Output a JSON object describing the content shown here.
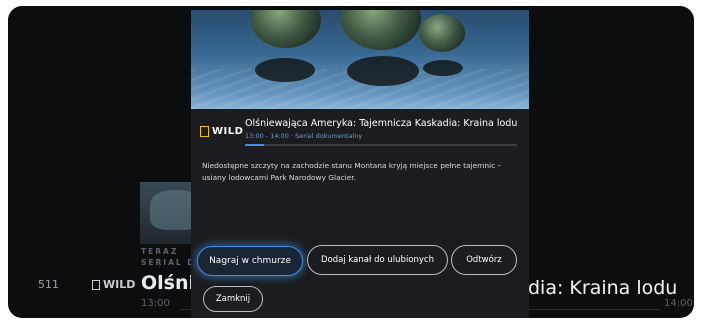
{
  "background_guide": {
    "channel_number": "511",
    "channel_logo": "WILD",
    "now_label": "TERAZ",
    "category_label": "SERIAL D",
    "title_left": "Olśnie",
    "title_right": "dia: Kraina lodu",
    "time_start": "13:00",
    "time_end": "14:00"
  },
  "modal": {
    "channel_logo": "WILD",
    "program_title": "Olśniewająca Ameryka: Tajemnicza Kaskadia: Kraina lodu",
    "time_range": "13:00 - 14:00",
    "genre": "Serial dokumentalny",
    "progress_fraction": 0.07,
    "description": "Niedostępne szczyty na zachodzie stanu Montana kryją miejsce pełne tajemnic – usiany lodowcami Park Narodowy Glacier.",
    "buttons": {
      "record": "Nagraj w chmurze",
      "add_favorite": "Dodaj kanał do ulubionych",
      "play": "Odtwórz",
      "close": "Zamknij"
    }
  },
  "colors": {
    "accent": "#3a8fe6",
    "brand_yellow": "#f2c400",
    "meta_blue": "#6c9bd2"
  }
}
